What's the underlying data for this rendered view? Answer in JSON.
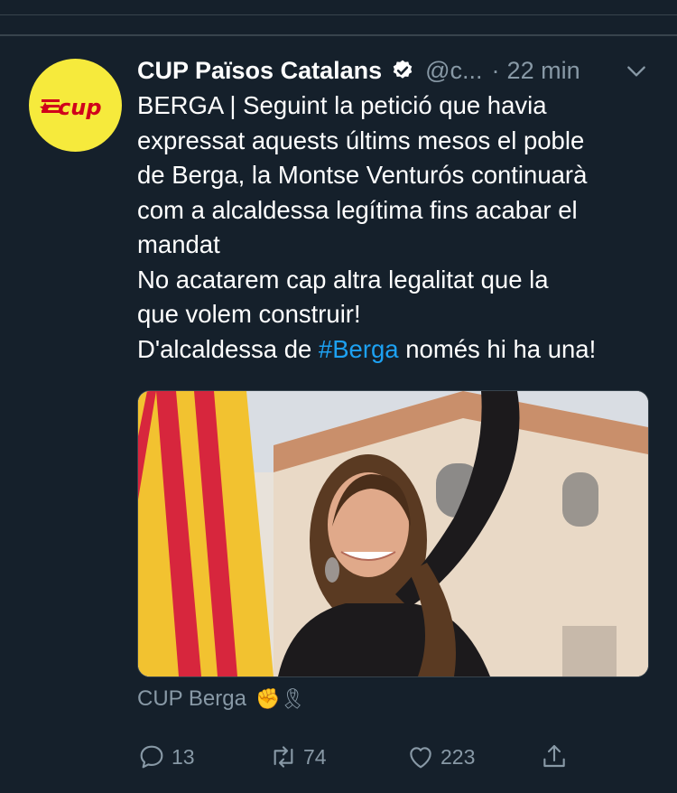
{
  "tweet": {
    "name": "CUP Països Catalans",
    "handle": "@c...",
    "separator": "·",
    "time": "22 min",
    "avatar_text": "cup",
    "body_lines": [
      "BERGA | Seguint la petició que havia",
      "expressat aquests últims mesos el poble",
      "de Berga, la Montse Venturós continuarà",
      "com a alcaldessa legítima fins acabar el",
      "mandat",
      "No acatarem cap altra legalitat que la",
      "que volem construir!"
    ],
    "last_line_before": "D'alcaldessa de ",
    "hashtag": "#Berga",
    "last_line_after": " només hi ha una!",
    "caption": "CUP Berga",
    "caption_emoji": "✊🎗",
    "reply_count": "13",
    "retweet_count": "74",
    "like_count": "223"
  },
  "icons": {
    "verified": "verified-badge-icon",
    "chevron": "chevron-down-icon",
    "reply": "reply-icon",
    "retweet": "retweet-icon",
    "like": "heart-icon",
    "share": "share-icon"
  },
  "colors": {
    "background": "#15202b",
    "text": "#ffffff",
    "muted": "#8899a6",
    "link": "#1da1f2",
    "avatar_bg": "#f6ea3c",
    "avatar_logo": "#d0021b"
  }
}
